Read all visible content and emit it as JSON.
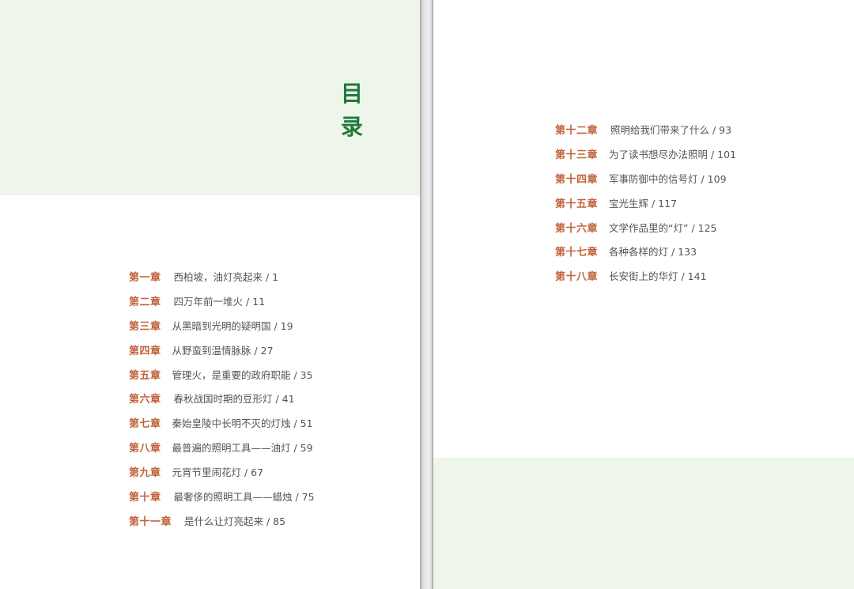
{
  "left_page": {
    "title_chars": [
      "目",
      "录"
    ],
    "entries": [
      {
        "chapter": "第一章",
        "title": "西柏坡，油灯亮起来 / 1"
      },
      {
        "chapter": "第二章",
        "title": "四万年前一堆火 / 11"
      },
      {
        "chapter": "第三章",
        "title": "从黑暗到光明的疑明国 / 19"
      },
      {
        "chapter": "第四章",
        "title": "从野蛮到温情脉脉 / 27"
      },
      {
        "chapter": "第五章",
        "title": "管理火，是重要的政府职能 / 35"
      },
      {
        "chapter": "第六章",
        "title": "春秋战国时期的豆形灯 / 41"
      },
      {
        "chapter": "第七章",
        "title": "秦始皇陵中长明不灭的灯烛 / 51"
      },
      {
        "chapter": "第八章",
        "title": "最普遍的照明工具——油灯 / 59"
      },
      {
        "chapter": "第九章",
        "title": "元宵节里闹花灯 / 67"
      },
      {
        "chapter": "第十章",
        "title": "最奢侈的照明工具——蜡烛 / 75"
      },
      {
        "chapter": "第十一章",
        "title": "是什么让灯亮起来 / 85"
      }
    ]
  },
  "right_page": {
    "entries": [
      {
        "chapter": "第十二章",
        "title": "照明给我们带来了什么 / 93"
      },
      {
        "chapter": "第十三章",
        "title": "为了读书想尽办法照明 / 101"
      },
      {
        "chapter": "第十四章",
        "title": "军事防御中的信号灯 / 109"
      },
      {
        "chapter": "第十五章",
        "title": "宝光生辉 / 117"
      },
      {
        "chapter": "第十六章",
        "title": "文学作品里的“灯” / 125"
      },
      {
        "chapter": "第十七章",
        "title": "各种各样的灯 / 133"
      },
      {
        "chapter": "第十八章",
        "title": "长安街上的华灯 / 141"
      }
    ]
  },
  "colors": {
    "band": "#eef5ea",
    "title": "#1f7a3a",
    "chapter": "#c0623a",
    "entry_text": "#555555"
  }
}
